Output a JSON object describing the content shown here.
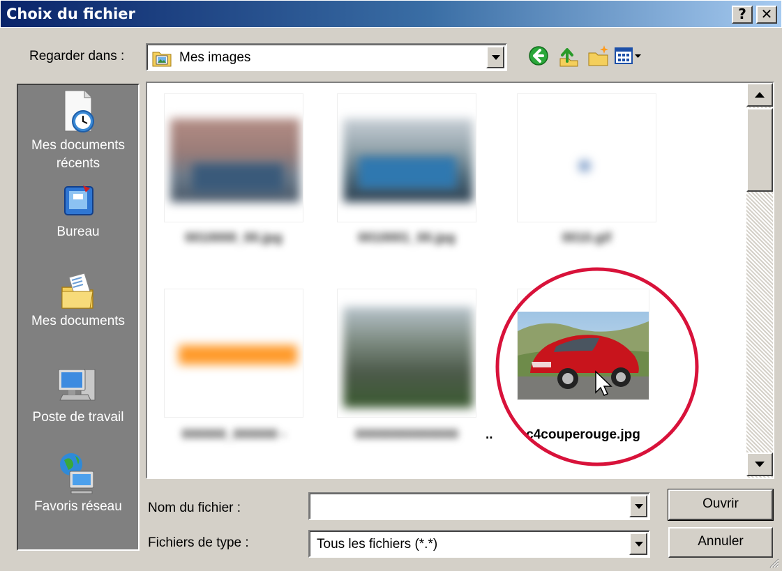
{
  "window": {
    "title": "Choix du fichier",
    "help_label": "?",
    "close_label": "✕"
  },
  "lookin": {
    "label": "Regarder dans :",
    "value": "Mes images"
  },
  "toolbar": {
    "icons": [
      "back-icon",
      "up-folder-icon",
      "new-folder-icon",
      "view-menu-icon"
    ]
  },
  "places": [
    {
      "label": "Mes documents récents",
      "icon": "recent-documents-icon"
    },
    {
      "label": "Bureau",
      "icon": "desktop-icon"
    },
    {
      "label": "Mes documents",
      "icon": "my-documents-icon"
    },
    {
      "label": "Poste de travail",
      "icon": "my-computer-icon"
    },
    {
      "label": "Favoris réseau",
      "icon": "network-places-icon"
    }
  ],
  "files": {
    "visible_name": "c4couperouge.jpg",
    "ellipsis": ".."
  },
  "filename": {
    "label": "Nom du fichier :",
    "value": ""
  },
  "filetype": {
    "label": "Fichiers de type :",
    "value": "Tous les fichiers (*.*)"
  },
  "buttons": {
    "open": "Ouvrir",
    "cancel": "Annuler"
  },
  "colors": {
    "title_bar": "#0a246a",
    "dialog_bg": "#d4d0c8",
    "places_bg": "#808080",
    "highlight_circle": "#d8123a",
    "car": "#c8141c"
  }
}
